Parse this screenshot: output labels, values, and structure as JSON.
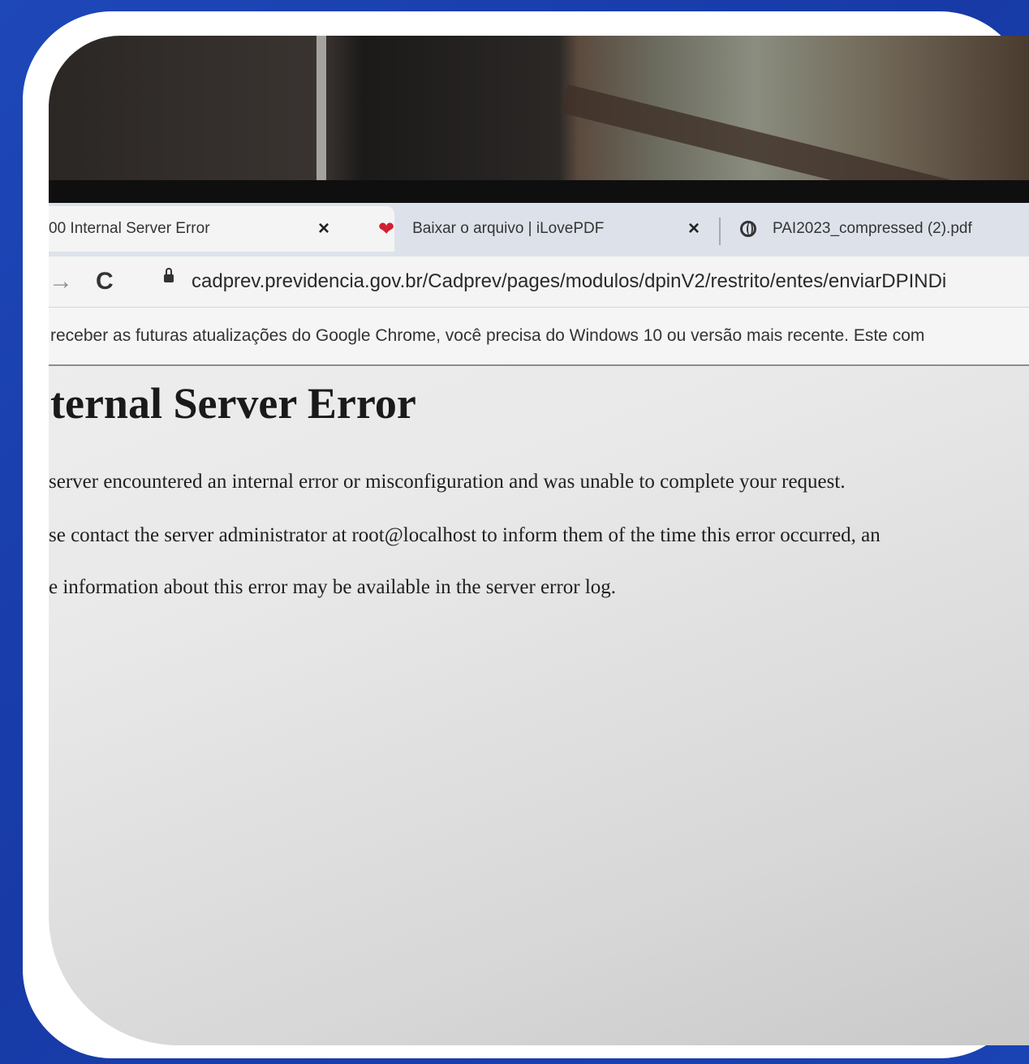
{
  "tabs": [
    {
      "title": "00 Internal Server Error",
      "icon": "none",
      "active": true,
      "close": "×"
    },
    {
      "title": "Baixar o arquivo | iLovePDF",
      "icon": "heart-icon",
      "active": false,
      "close": "×"
    },
    {
      "title": "PAI2023_compressed (2).pdf",
      "icon": "globe-icon",
      "active": false
    }
  ],
  "toolbar": {
    "url": "cadprev.previdencia.gov.br/Cadprev/pages/modulos/dpinV2/restrito/entes/enviarDPINDi"
  },
  "infobar": {
    "message": "receber as futuras atualizações do Google Chrome, você precisa do Windows 10 ou versão mais recente. Este com"
  },
  "page": {
    "heading": "ternal Server Error",
    "paragraphs": [
      "server encountered an internal error or misconfiguration and was unable to complete your request.",
      "se contact the server administrator at root@localhost to inform them of the time this error occurred, an",
      "e information about this error may be available in the server error log."
    ]
  },
  "colors": {
    "background": "#1e47b8",
    "frame": "#ffffff",
    "heart": "#d11f31"
  }
}
